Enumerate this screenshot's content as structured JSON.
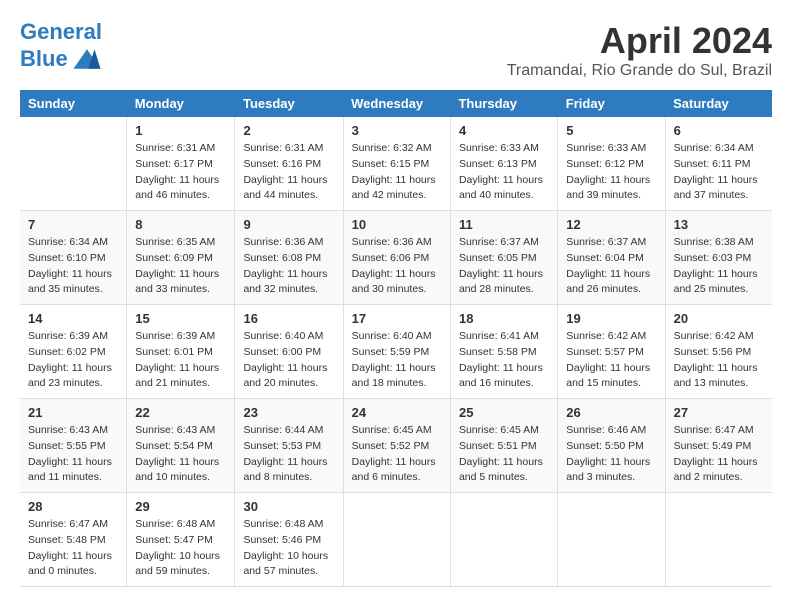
{
  "header": {
    "logo_line1": "General",
    "logo_line2": "Blue",
    "month": "April 2024",
    "location": "Tramandai, Rio Grande do Sul, Brazil"
  },
  "weekdays": [
    "Sunday",
    "Monday",
    "Tuesday",
    "Wednesday",
    "Thursday",
    "Friday",
    "Saturday"
  ],
  "weeks": [
    [
      {
        "day": "",
        "info": ""
      },
      {
        "day": "1",
        "info": "Sunrise: 6:31 AM\nSunset: 6:17 PM\nDaylight: 11 hours\nand 46 minutes."
      },
      {
        "day": "2",
        "info": "Sunrise: 6:31 AM\nSunset: 6:16 PM\nDaylight: 11 hours\nand 44 minutes."
      },
      {
        "day": "3",
        "info": "Sunrise: 6:32 AM\nSunset: 6:15 PM\nDaylight: 11 hours\nand 42 minutes."
      },
      {
        "day": "4",
        "info": "Sunrise: 6:33 AM\nSunset: 6:13 PM\nDaylight: 11 hours\nand 40 minutes."
      },
      {
        "day": "5",
        "info": "Sunrise: 6:33 AM\nSunset: 6:12 PM\nDaylight: 11 hours\nand 39 minutes."
      },
      {
        "day": "6",
        "info": "Sunrise: 6:34 AM\nSunset: 6:11 PM\nDaylight: 11 hours\nand 37 minutes."
      }
    ],
    [
      {
        "day": "7",
        "info": "Sunrise: 6:34 AM\nSunset: 6:10 PM\nDaylight: 11 hours\nand 35 minutes."
      },
      {
        "day": "8",
        "info": "Sunrise: 6:35 AM\nSunset: 6:09 PM\nDaylight: 11 hours\nand 33 minutes."
      },
      {
        "day": "9",
        "info": "Sunrise: 6:36 AM\nSunset: 6:08 PM\nDaylight: 11 hours\nand 32 minutes."
      },
      {
        "day": "10",
        "info": "Sunrise: 6:36 AM\nSunset: 6:06 PM\nDaylight: 11 hours\nand 30 minutes."
      },
      {
        "day": "11",
        "info": "Sunrise: 6:37 AM\nSunset: 6:05 PM\nDaylight: 11 hours\nand 28 minutes."
      },
      {
        "day": "12",
        "info": "Sunrise: 6:37 AM\nSunset: 6:04 PM\nDaylight: 11 hours\nand 26 minutes."
      },
      {
        "day": "13",
        "info": "Sunrise: 6:38 AM\nSunset: 6:03 PM\nDaylight: 11 hours\nand 25 minutes."
      }
    ],
    [
      {
        "day": "14",
        "info": "Sunrise: 6:39 AM\nSunset: 6:02 PM\nDaylight: 11 hours\nand 23 minutes."
      },
      {
        "day": "15",
        "info": "Sunrise: 6:39 AM\nSunset: 6:01 PM\nDaylight: 11 hours\nand 21 minutes."
      },
      {
        "day": "16",
        "info": "Sunrise: 6:40 AM\nSunset: 6:00 PM\nDaylight: 11 hours\nand 20 minutes."
      },
      {
        "day": "17",
        "info": "Sunrise: 6:40 AM\nSunset: 5:59 PM\nDaylight: 11 hours\nand 18 minutes."
      },
      {
        "day": "18",
        "info": "Sunrise: 6:41 AM\nSunset: 5:58 PM\nDaylight: 11 hours\nand 16 minutes."
      },
      {
        "day": "19",
        "info": "Sunrise: 6:42 AM\nSunset: 5:57 PM\nDaylight: 11 hours\nand 15 minutes."
      },
      {
        "day": "20",
        "info": "Sunrise: 6:42 AM\nSunset: 5:56 PM\nDaylight: 11 hours\nand 13 minutes."
      }
    ],
    [
      {
        "day": "21",
        "info": "Sunrise: 6:43 AM\nSunset: 5:55 PM\nDaylight: 11 hours\nand 11 minutes."
      },
      {
        "day": "22",
        "info": "Sunrise: 6:43 AM\nSunset: 5:54 PM\nDaylight: 11 hours\nand 10 minutes."
      },
      {
        "day": "23",
        "info": "Sunrise: 6:44 AM\nSunset: 5:53 PM\nDaylight: 11 hours\nand 8 minutes."
      },
      {
        "day": "24",
        "info": "Sunrise: 6:45 AM\nSunset: 5:52 PM\nDaylight: 11 hours\nand 6 minutes."
      },
      {
        "day": "25",
        "info": "Sunrise: 6:45 AM\nSunset: 5:51 PM\nDaylight: 11 hours\nand 5 minutes."
      },
      {
        "day": "26",
        "info": "Sunrise: 6:46 AM\nSunset: 5:50 PM\nDaylight: 11 hours\nand 3 minutes."
      },
      {
        "day": "27",
        "info": "Sunrise: 6:47 AM\nSunset: 5:49 PM\nDaylight: 11 hours\nand 2 minutes."
      }
    ],
    [
      {
        "day": "28",
        "info": "Sunrise: 6:47 AM\nSunset: 5:48 PM\nDaylight: 11 hours\nand 0 minutes."
      },
      {
        "day": "29",
        "info": "Sunrise: 6:48 AM\nSunset: 5:47 PM\nDaylight: 10 hours\nand 59 minutes."
      },
      {
        "day": "30",
        "info": "Sunrise: 6:48 AM\nSunset: 5:46 PM\nDaylight: 10 hours\nand 57 minutes."
      },
      {
        "day": "",
        "info": ""
      },
      {
        "day": "",
        "info": ""
      },
      {
        "day": "",
        "info": ""
      },
      {
        "day": "",
        "info": ""
      }
    ]
  ]
}
